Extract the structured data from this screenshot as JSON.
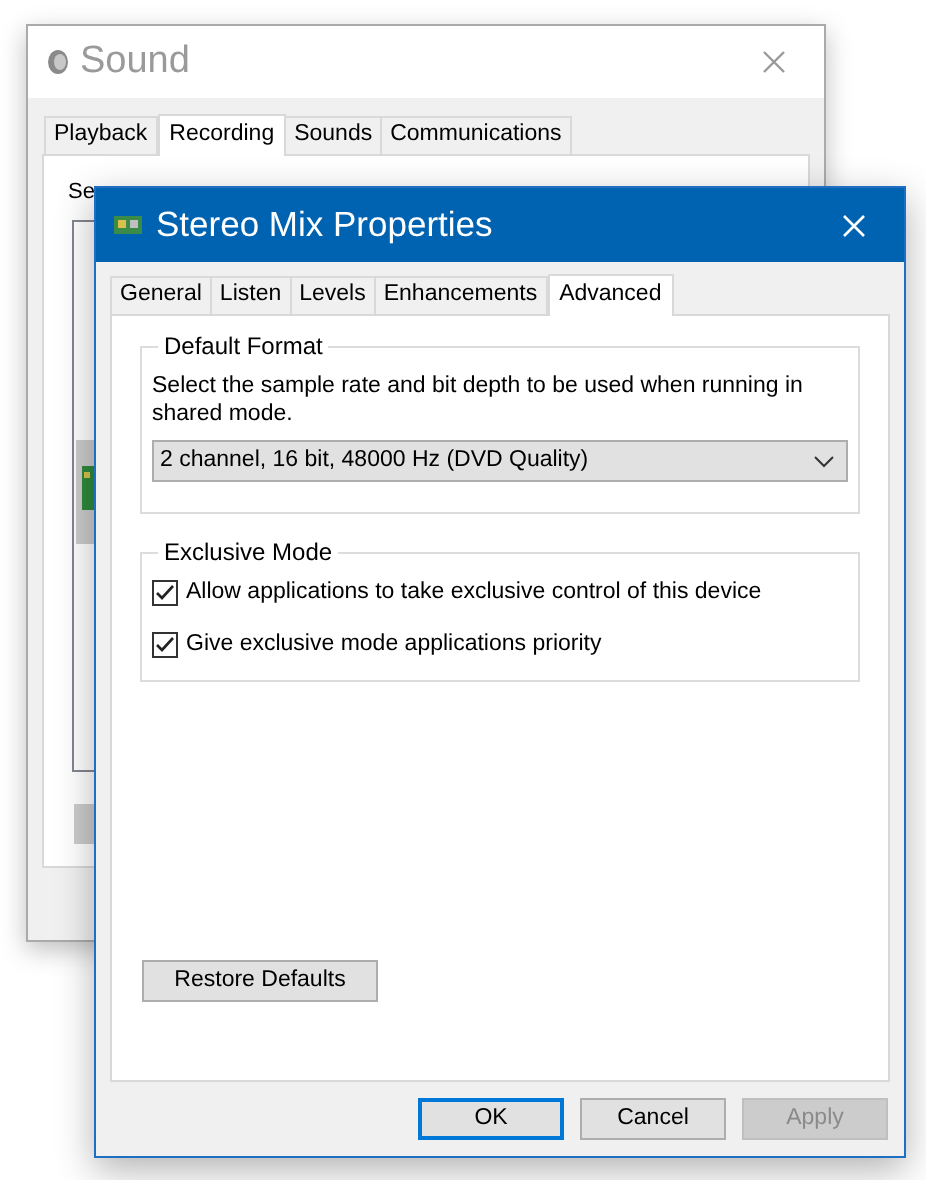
{
  "back_window": {
    "title": "Sound",
    "tabs": [
      {
        "label": "Playback",
        "selected": false
      },
      {
        "label": "Recording",
        "selected": true
      },
      {
        "label": "Sounds",
        "selected": false
      },
      {
        "label": "Communications",
        "selected": false
      }
    ],
    "instruction": "Se"
  },
  "dialog": {
    "title": "Stereo Mix Properties",
    "tabs": [
      {
        "label": "General",
        "selected": false
      },
      {
        "label": "Listen",
        "selected": false
      },
      {
        "label": "Levels",
        "selected": false
      },
      {
        "label": "Enhancements",
        "selected": false
      },
      {
        "label": "Advanced",
        "selected": true
      }
    ],
    "default_format": {
      "legend": "Default Format",
      "description": "Select the sample rate and bit depth to be used when running in shared mode.",
      "value": "2 channel, 16 bit, 48000 Hz (DVD Quality)"
    },
    "exclusive_mode": {
      "legend": "Exclusive Mode",
      "options": [
        {
          "label": "Allow applications to take exclusive control of this device",
          "checked": true
        },
        {
          "label": "Give exclusive mode applications priority",
          "checked": true
        }
      ]
    },
    "restore_button": "Restore Defaults",
    "buttons": [
      {
        "label": "OK",
        "kind": "default",
        "disabled": false
      },
      {
        "label": "Cancel",
        "kind": "normal",
        "disabled": false
      },
      {
        "label": "Apply",
        "kind": "normal",
        "disabled": true
      }
    ]
  }
}
